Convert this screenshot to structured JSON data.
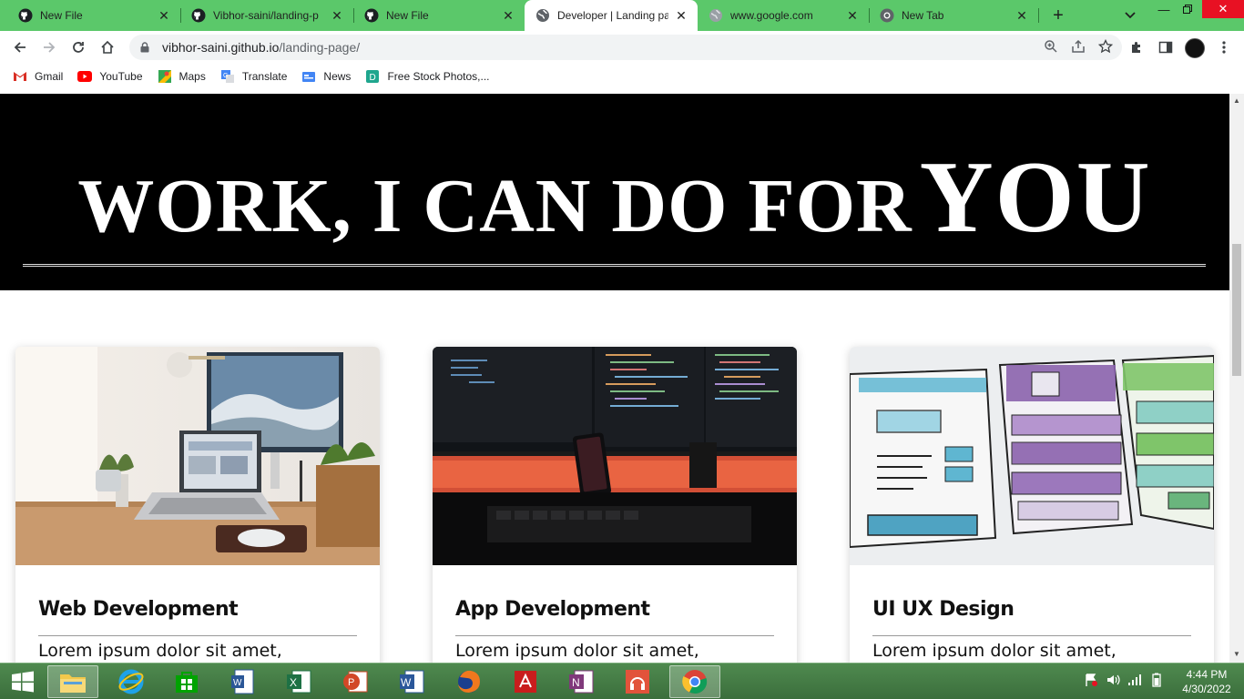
{
  "browser": {
    "tabs": [
      {
        "title": "New File",
        "favicon": "github-icon"
      },
      {
        "title": "Vibhor-saini/landing-p",
        "favicon": "github-icon"
      },
      {
        "title": "New File",
        "favicon": "github-icon"
      },
      {
        "title": "Developer | Landing pa",
        "favicon": "globe-icon",
        "active": true
      },
      {
        "title": "www.google.com",
        "favicon": "globe-gray-icon"
      },
      {
        "title": "New Tab",
        "favicon": "chrome-icon"
      }
    ],
    "url": {
      "host": "vibhor-saini.github.io",
      "path": "/landing-page/"
    },
    "bookmarks": [
      {
        "label": "Gmail",
        "icon": "gmail-icon"
      },
      {
        "label": "YouTube",
        "icon": "youtube-icon"
      },
      {
        "label": "Maps",
        "icon": "maps-icon"
      },
      {
        "label": "Translate",
        "icon": "translate-icon"
      },
      {
        "label": "News",
        "icon": "news-icon"
      },
      {
        "label": "Free Stock Photos,...",
        "icon": "stock-photos-icon"
      }
    ],
    "colors": {
      "tabstrip": "#5bc86a",
      "close_window": "#e81123"
    }
  },
  "page": {
    "hero": {
      "title_small": "WORK, I CAN DO FOR",
      "title_big": "YOU"
    },
    "cards": [
      {
        "title": "Web Development",
        "text": "Lorem ipsum dolor sit amet,",
        "image": "laptop-desk-photo"
      },
      {
        "title": "App Development",
        "text": "Lorem ipsum dolor sit amet,",
        "image": "code-monitors-photo"
      },
      {
        "title": "UI UX Design",
        "text": "Lorem ipsum dolor sit amet,",
        "image": "wireframe-sketch-photo"
      }
    ]
  },
  "taskbar": {
    "apps": [
      "file-explorer",
      "internet-explorer",
      "store",
      "word-viewer",
      "excel",
      "powerpoint",
      "word",
      "firefox",
      "acrobat",
      "onenote",
      "music",
      "chrome"
    ],
    "time": "4:44 PM",
    "date": "4/30/2022"
  }
}
